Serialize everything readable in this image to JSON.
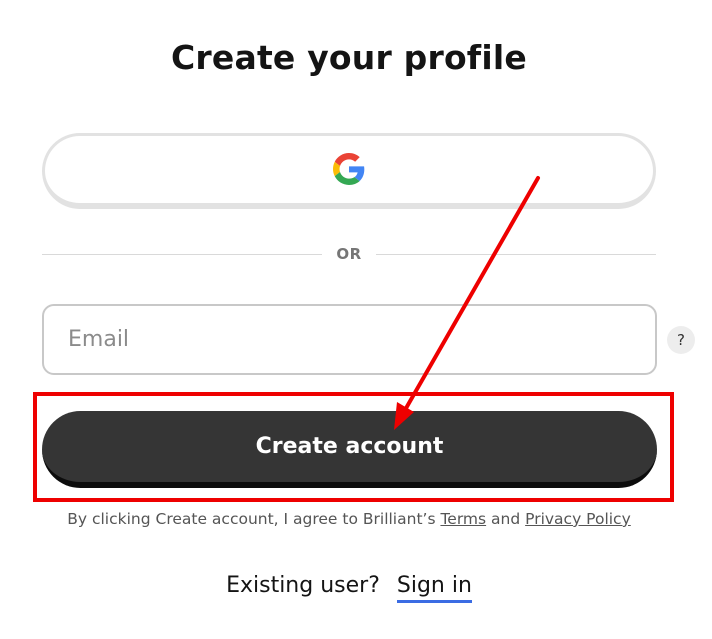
{
  "title": "Create your profile",
  "google_button": {
    "icon": "google-logo-icon"
  },
  "divider_text": "OR",
  "email_field": {
    "placeholder": "Email",
    "value": ""
  },
  "help_button": {
    "label": "?"
  },
  "create_button": {
    "label": "Create account"
  },
  "terms": {
    "prefix": "By clicking Create account, I agree to Brilliant’s ",
    "terms_link": "Terms",
    "middle": " and ",
    "privacy_link": "Privacy Policy"
  },
  "existing_user": {
    "prompt": "Existing user?",
    "sign_in_link": "Sign in"
  },
  "annotation": {
    "color": "#ee0000",
    "type": "arrow-and-highlight-box"
  },
  "colors": {
    "primary_button": "#353535",
    "link_underline": "#3b6ce3"
  }
}
